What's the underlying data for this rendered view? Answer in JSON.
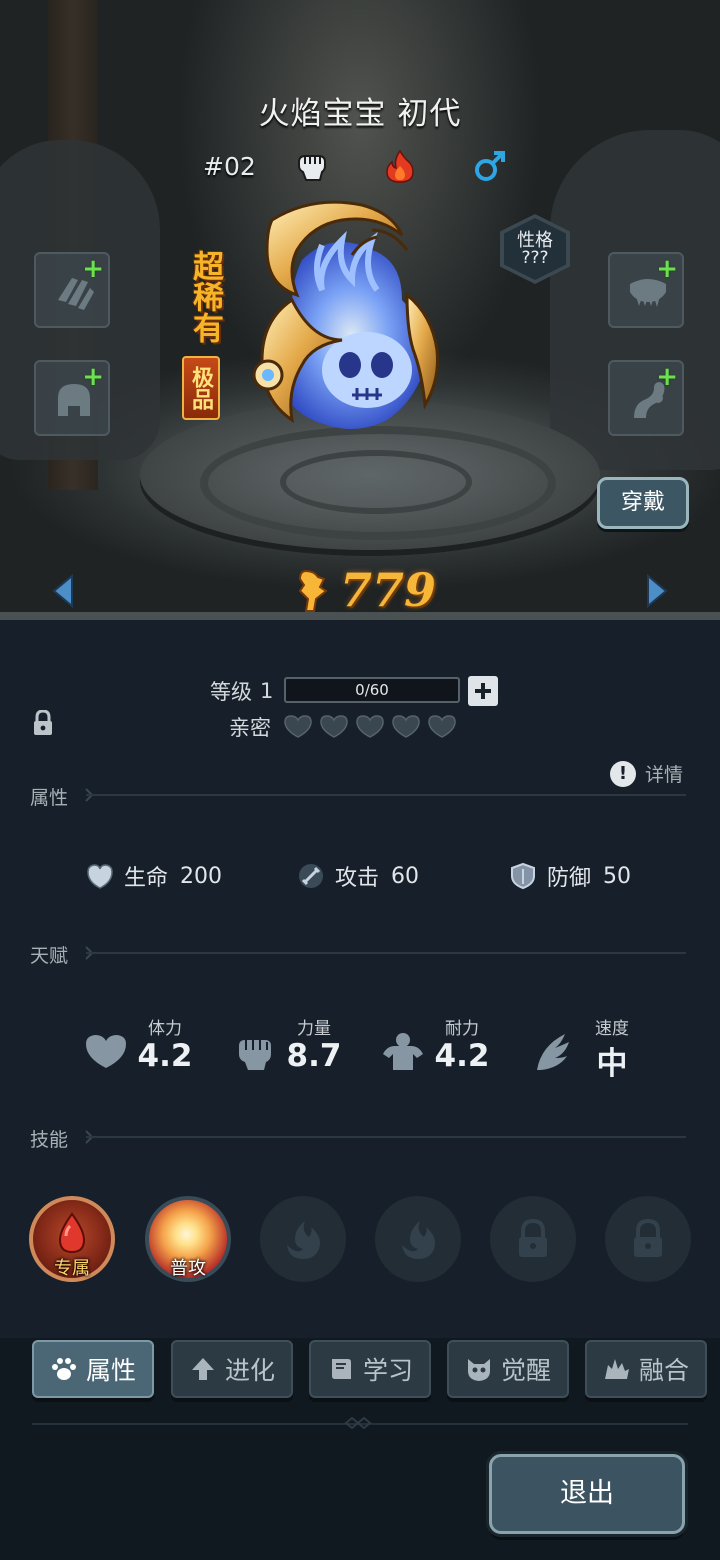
{
  "pet": {
    "name": "火焰宝宝 初代",
    "number": "#02",
    "rarity": "超稀有",
    "grade": "极品",
    "power": "779",
    "personality_label": "性格",
    "personality_value": "???"
  },
  "scene": {
    "wear_button": "穿戴",
    "equip_slots": [
      "claw-slot",
      "head-slot",
      "jaw-slot",
      "tail-slot"
    ]
  },
  "level": {
    "label": "等级",
    "value": "1",
    "xp_text": "0/60",
    "xp_fraction": 0,
    "intimacy_label": "亲密",
    "intimacy_hearts_filled": 0,
    "intimacy_hearts_total": 5
  },
  "sections": {
    "attributes": "属性",
    "talent": "天赋",
    "skills": "技能",
    "detail": "详情"
  },
  "stats": [
    {
      "icon": "heart-shield-icon",
      "label": "生命",
      "value": "200"
    },
    {
      "icon": "sword-icon",
      "label": "攻击",
      "value": "60"
    },
    {
      "icon": "shield-icon",
      "label": "防御",
      "value": "50"
    }
  ],
  "talents": [
    {
      "icon": "heart-icon",
      "label": "体力",
      "value": "4.2"
    },
    {
      "icon": "fist-icon",
      "label": "力量",
      "value": "8.7"
    },
    {
      "icon": "muscle-icon",
      "label": "耐力",
      "value": "4.2"
    },
    {
      "icon": "wing-icon",
      "label": "速度",
      "value": "中"
    }
  ],
  "skills": [
    {
      "type": "exclusive",
      "caption": "专属"
    },
    {
      "type": "normal",
      "caption": "普攻"
    },
    {
      "type": "empty",
      "icon": "flame-icon"
    },
    {
      "type": "empty",
      "icon": "flame-icon"
    },
    {
      "type": "locked",
      "icon": "lock-icon"
    },
    {
      "type": "locked",
      "icon": "lock-icon"
    }
  ],
  "tabs": [
    {
      "label": "属性",
      "icon": "paw-icon",
      "active": true
    },
    {
      "label": "进化",
      "icon": "up-arrow-icon",
      "active": false
    },
    {
      "label": "学习",
      "icon": "book-icon",
      "active": false
    },
    {
      "label": "觉醒",
      "icon": "mask-icon",
      "active": false
    },
    {
      "label": "融合",
      "icon": "fusion-icon",
      "active": false
    }
  ],
  "exit_button": "退出",
  "colors": {
    "panel_bg": "#17202a",
    "power_gold": "#f8b638",
    "plus_green": "#6ce04e",
    "active_tab": "#4b6775"
  }
}
